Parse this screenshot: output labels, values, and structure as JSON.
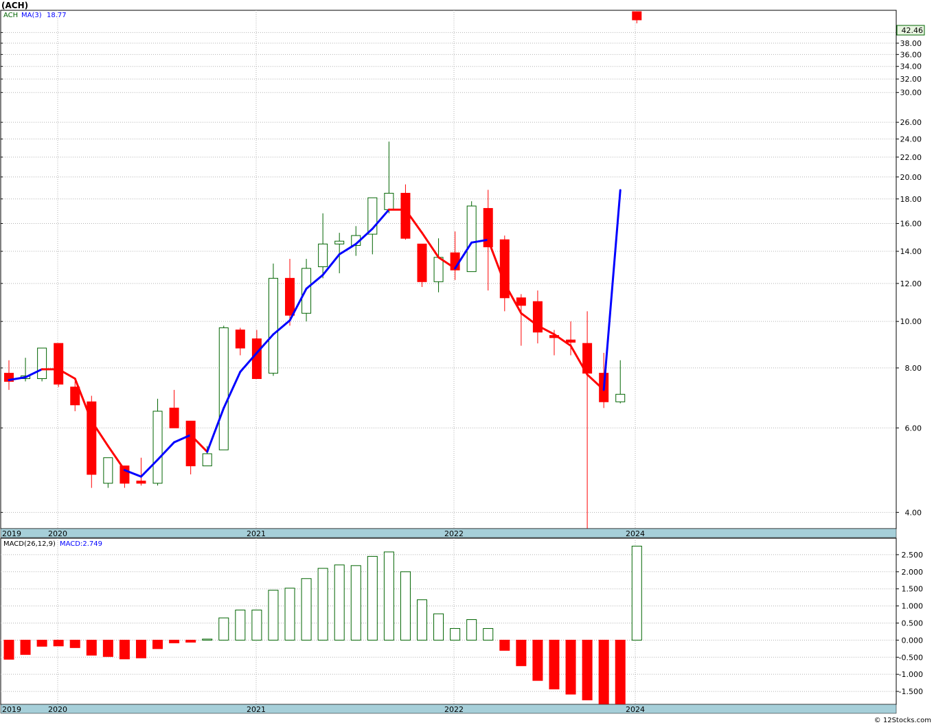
{
  "header": {
    "title": "(ACH)"
  },
  "footer": {
    "copyright": "© 12Stocks.com"
  },
  "colors": {
    "up": "#006400",
    "down": "#ff0000",
    "ma_up": "#0000ff",
    "ma_down": "#ff0000",
    "axis_band": "#a6cfd9",
    "grid": "#b0b0b0",
    "price_tag_bg": "#e8f5e1"
  },
  "chart_data": [
    {
      "type": "candlestick",
      "legend": {
        "symbol": "ACH",
        "ma_label": "MA(3)",
        "ma_value": "18.77"
      },
      "scale": "log",
      "ylim": [
        3.7,
        44.5
      ],
      "y_ticks": [
        "4.00",
        "6.00",
        "8.00",
        "10.00",
        "12.00",
        "14.00",
        "16.00",
        "18.00",
        "20.00",
        "22.00",
        "24.00",
        "26.00",
        "30.00",
        "32.00",
        "34.00",
        "36.00",
        "38.00",
        "40.00"
      ],
      "last_price_label": "42.46",
      "x_tick_labels": [
        "2019",
        "2020",
        "2021",
        "2022",
        "2024"
      ],
      "candles": [
        {
          "o": 7.5,
          "h": 8.3,
          "l": 7.2,
          "c": 7.8,
          "color": "red"
        },
        {
          "o": 7.6,
          "h": 8.4,
          "l": 7.5,
          "c": 7.7,
          "color": "green"
        },
        {
          "o": 7.6,
          "h": 8.8,
          "l": 7.5,
          "c": 8.8,
          "color": "green"
        },
        {
          "o": 9.0,
          "h": 9.0,
          "l": 7.3,
          "c": 7.4,
          "color": "red"
        },
        {
          "o": 7.3,
          "h": 7.5,
          "l": 6.5,
          "c": 6.7,
          "color": "red"
        },
        {
          "o": 6.8,
          "h": 7.0,
          "l": 4.5,
          "c": 4.8,
          "color": "red"
        },
        {
          "o": 4.6,
          "h": 5.2,
          "l": 4.5,
          "c": 5.2,
          "color": "green"
        },
        {
          "o": 5.0,
          "h": 5.0,
          "l": 4.5,
          "c": 4.6,
          "color": "red"
        },
        {
          "o": 4.65,
          "h": 5.2,
          "l": 4.55,
          "c": 4.6,
          "color": "red"
        },
        {
          "o": 4.6,
          "h": 6.9,
          "l": 4.55,
          "c": 6.5,
          "color": "green"
        },
        {
          "o": 6.6,
          "h": 7.2,
          "l": 6.0,
          "c": 6.0,
          "color": "red"
        },
        {
          "o": 6.2,
          "h": 6.2,
          "l": 4.8,
          "c": 5.0,
          "color": "red"
        },
        {
          "o": 5.0,
          "h": 5.5,
          "l": 5.0,
          "c": 5.3,
          "color": "green"
        },
        {
          "o": 5.4,
          "h": 9.8,
          "l": 5.4,
          "c": 9.7,
          "color": "green"
        },
        {
          "o": 9.6,
          "h": 9.7,
          "l": 8.5,
          "c": 8.8,
          "color": "red"
        },
        {
          "o": 9.2,
          "h": 9.6,
          "l": 7.6,
          "c": 7.6,
          "color": "red"
        },
        {
          "o": 7.8,
          "h": 13.2,
          "l": 7.7,
          "c": 12.3,
          "color": "green"
        },
        {
          "o": 12.3,
          "h": 13.5,
          "l": 9.8,
          "c": 10.3,
          "color": "red"
        },
        {
          "o": 10.4,
          "h": 13.5,
          "l": 10.0,
          "c": 12.9,
          "color": "green"
        },
        {
          "o": 13.0,
          "h": 16.8,
          "l": 12.3,
          "c": 14.5,
          "color": "green"
        },
        {
          "o": 14.5,
          "h": 15.3,
          "l": 12.6,
          "c": 14.7,
          "color": "green"
        },
        {
          "o": 14.4,
          "h": 15.8,
          "l": 13.7,
          "c": 15.1,
          "color": "green"
        },
        {
          "o": 15.2,
          "h": 18.1,
          "l": 13.8,
          "c": 18.1,
          "color": "green"
        },
        {
          "o": 17.1,
          "h": 23.7,
          "l": 16.8,
          "c": 18.5,
          "color": "green"
        },
        {
          "o": 18.5,
          "h": 19.3,
          "l": 14.8,
          "c": 14.9,
          "color": "red"
        },
        {
          "o": 14.5,
          "h": 14.5,
          "l": 11.8,
          "c": 12.1,
          "color": "red"
        },
        {
          "o": 12.1,
          "h": 14.9,
          "l": 11.5,
          "c": 13.6,
          "color": "green"
        },
        {
          "o": 13.9,
          "h": 15.4,
          "l": 12.2,
          "c": 12.8,
          "color": "red"
        },
        {
          "o": 12.7,
          "h": 17.8,
          "l": 12.7,
          "c": 17.4,
          "color": "green"
        },
        {
          "o": 17.2,
          "h": 18.8,
          "l": 11.6,
          "c": 14.3,
          "color": "red"
        },
        {
          "o": 14.8,
          "h": 15.1,
          "l": 10.5,
          "c": 11.2,
          "color": "red"
        },
        {
          "o": 11.2,
          "h": 11.4,
          "l": 8.9,
          "c": 10.8,
          "color": "red"
        },
        {
          "o": 11.0,
          "h": 11.6,
          "l": 9.0,
          "c": 9.5,
          "color": "red"
        },
        {
          "o": 9.35,
          "h": 9.6,
          "l": 8.5,
          "c": 9.25,
          "color": "red"
        },
        {
          "o": 9.15,
          "h": 10.0,
          "l": 8.5,
          "c": 9.05,
          "color": "red"
        },
        {
          "o": 9.0,
          "h": 10.5,
          "l": 3.7,
          "c": 7.8,
          "color": "red"
        },
        {
          "o": 7.8,
          "h": 8.6,
          "l": 6.6,
          "c": 6.8,
          "color": "red"
        },
        {
          "o": 6.8,
          "h": 8.3,
          "l": 6.75,
          "c": 7.05,
          "color": "green"
        },
        {
          "o": 44.2,
          "h": 44.2,
          "l": 41.8,
          "c": 42.5,
          "color": "red"
        }
      ],
      "ma_values": [
        7.55,
        7.65,
        7.95,
        7.95,
        7.6,
        6.2,
        5.5,
        4.9,
        4.75,
        5.15,
        5.6,
        5.8,
        5.35,
        6.6,
        7.85,
        8.6,
        9.4,
        10.05,
        11.7,
        12.5,
        13.8,
        14.5,
        15.6,
        17.1,
        17.1,
        15.3,
        13.6,
        12.9,
        14.6,
        14.8,
        12.0,
        10.4,
        9.8,
        9.4,
        8.9,
        7.75,
        7.2,
        18.77
      ],
      "ma_colors": [
        "blue",
        "blue",
        "blue",
        "red",
        "red",
        "red",
        "red",
        "red",
        "blue",
        "blue",
        "blue",
        "blue",
        "red",
        "blue",
        "blue",
        "blue",
        "blue",
        "blue",
        "blue",
        "blue",
        "blue",
        "blue",
        "blue",
        "blue",
        "red",
        "red",
        "red",
        "red",
        "blue",
        "blue",
        "red",
        "red",
        "red",
        "red",
        "red",
        "red",
        "red",
        "blue"
      ]
    },
    {
      "type": "bar",
      "legend": {
        "label": "MACD(26,12,9)",
        "value_label": "MACD:2.749"
      },
      "ylim": [
        -1.88,
        2.98
      ],
      "y_ticks": [
        "2.500",
        "2.000",
        "1.500",
        "1.000",
        "0.500",
        "0.000",
        "-0.500",
        "-1.000",
        "-1.500"
      ],
      "x_tick_labels": [
        "2019",
        "2020",
        "2021",
        "2022",
        "2024"
      ],
      "values": [
        -0.56,
        -0.42,
        -0.18,
        -0.17,
        -0.22,
        -0.44,
        -0.48,
        -0.55,
        -0.52,
        -0.25,
        -0.08,
        -0.06,
        0.03,
        0.65,
        0.88,
        0.88,
        1.46,
        1.52,
        1.8,
        2.1,
        2.2,
        2.18,
        2.45,
        2.58,
        2.0,
        1.18,
        0.77,
        0.34,
        0.6,
        0.34,
        -0.3,
        -0.75,
        -1.18,
        -1.43,
        -1.58,
        -1.75,
        -1.88,
        -1.9,
        2.75
      ]
    }
  ]
}
